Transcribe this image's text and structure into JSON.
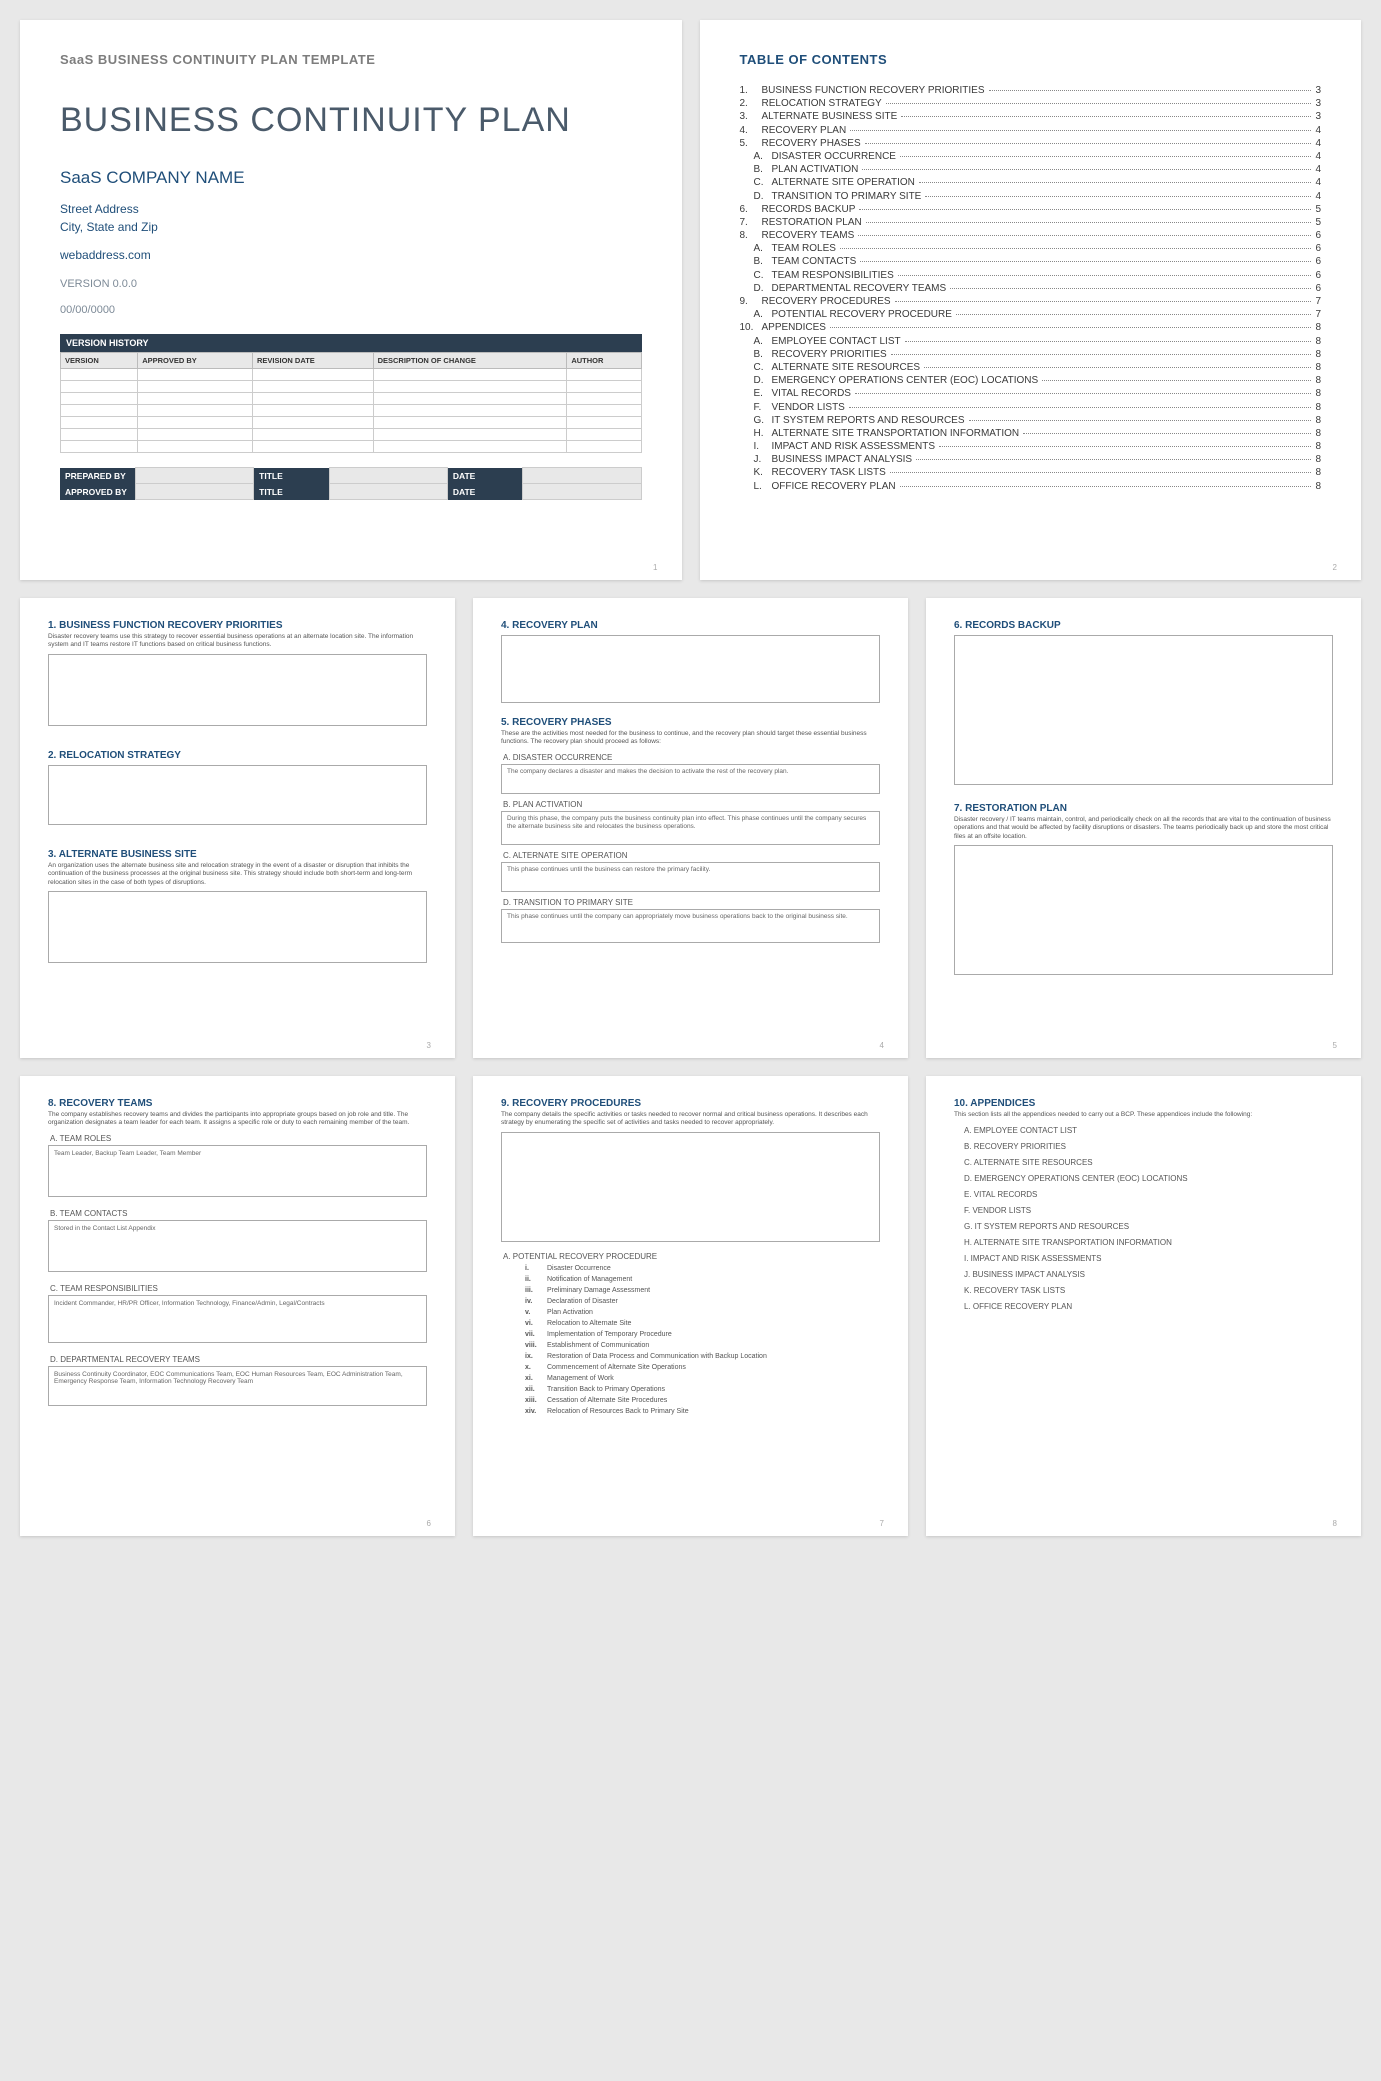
{
  "page1": {
    "header": "SaaS BUSINESS CONTINUITY PLAN TEMPLATE",
    "title": "BUSINESS CONTINUITY PLAN",
    "company": "SaaS COMPANY NAME",
    "street": "Street Address",
    "city": "City, State and Zip",
    "web": "webaddress.com",
    "version": "VERSION 0.0.0",
    "date": "00/00/0000",
    "vh_title": "VERSION HISTORY",
    "vh_cols": [
      "VERSION",
      "APPROVED BY",
      "REVISION DATE",
      "DESCRIPTION OF CHANGE",
      "AUTHOR"
    ],
    "sig": {
      "prepared": "PREPARED BY",
      "approved": "APPROVED BY",
      "title": "TITLE",
      "date": "DATE"
    },
    "pnum": "1"
  },
  "page2": {
    "title": "TABLE OF CONTENTS",
    "items": [
      {
        "n": "1.",
        "t": "BUSINESS FUNCTION RECOVERY PRIORITIES",
        "p": "3"
      },
      {
        "n": "2.",
        "t": "RELOCATION STRATEGY",
        "p": "3"
      },
      {
        "n": "3.",
        "t": "ALTERNATE BUSINESS SITE",
        "p": "3"
      },
      {
        "n": "4.",
        "t": "RECOVERY PLAN",
        "p": "4"
      },
      {
        "n": "5.",
        "t": "RECOVERY PHASES",
        "p": "4"
      },
      {
        "n": "A.",
        "t": "DISASTER OCCURRENCE",
        "p": "4",
        "sub": true
      },
      {
        "n": "B.",
        "t": "PLAN ACTIVATION",
        "p": "4",
        "sub": true
      },
      {
        "n": "C.",
        "t": "ALTERNATE SITE OPERATION",
        "p": "4",
        "sub": true
      },
      {
        "n": "D.",
        "t": "TRANSITION TO PRIMARY SITE",
        "p": "4",
        "sub": true
      },
      {
        "n": "6.",
        "t": "RECORDS BACKUP",
        "p": "5"
      },
      {
        "n": "7.",
        "t": "RESTORATION PLAN",
        "p": "5"
      },
      {
        "n": "8.",
        "t": "RECOVERY TEAMS",
        "p": "6"
      },
      {
        "n": "A.",
        "t": "TEAM ROLES",
        "p": "6",
        "sub": true
      },
      {
        "n": "B.",
        "t": "TEAM CONTACTS",
        "p": "6",
        "sub": true
      },
      {
        "n": "C.",
        "t": "TEAM RESPONSIBILITIES",
        "p": "6",
        "sub": true
      },
      {
        "n": "D.",
        "t": "DEPARTMENTAL RECOVERY TEAMS",
        "p": "6",
        "sub": true
      },
      {
        "n": "9.",
        "t": "RECOVERY PROCEDURES",
        "p": "7"
      },
      {
        "n": "A.",
        "t": "POTENTIAL RECOVERY PROCEDURE",
        "p": "7",
        "sub": true
      },
      {
        "n": "10.",
        "t": "APPENDICES",
        "p": "8"
      },
      {
        "n": "A.",
        "t": "EMPLOYEE CONTACT LIST",
        "p": "8",
        "sub": true
      },
      {
        "n": "B.",
        "t": "RECOVERY PRIORITIES",
        "p": "8",
        "sub": true
      },
      {
        "n": "C.",
        "t": "ALTERNATE SITE RESOURCES",
        "p": "8",
        "sub": true
      },
      {
        "n": "D.",
        "t": "EMERGENCY OPERATIONS CENTER (EOC) LOCATIONS",
        "p": "8",
        "sub": true
      },
      {
        "n": "E.",
        "t": "VITAL RECORDS",
        "p": "8",
        "sub": true
      },
      {
        "n": "F.",
        "t": "VENDOR LISTS",
        "p": "8",
        "sub": true
      },
      {
        "n": "G.",
        "t": "IT SYSTEM REPORTS AND RESOURCES",
        "p": "8",
        "sub": true
      },
      {
        "n": "H.",
        "t": "ALTERNATE SITE TRANSPORTATION INFORMATION",
        "p": "8",
        "sub": true
      },
      {
        "n": "I.",
        "t": "IMPACT AND RISK ASSESSMENTS",
        "p": "8",
        "sub": true
      },
      {
        "n": "J.",
        "t": "BUSINESS IMPACT ANALYSIS",
        "p": "8",
        "sub": true
      },
      {
        "n": "K.",
        "t": "RECOVERY TASK LISTS",
        "p": "8",
        "sub": true
      },
      {
        "n": "L.",
        "t": "OFFICE RECOVERY PLAN",
        "p": "8",
        "sub": true
      }
    ],
    "pnum": "2"
  },
  "page3": {
    "s1_title": "1. BUSINESS FUNCTION RECOVERY PRIORITIES",
    "s1_desc": "Disaster recovery teams use this strategy to recover essential business operations at an alternate location site. The information system and IT teams restore IT functions based on critical business functions.",
    "s2_title": "2. RELOCATION STRATEGY",
    "s3_title": "3. ALTERNATE BUSINESS SITE",
    "s3_desc": "An organization uses the alternate business site and relocation strategy in the event of a disaster or disruption that inhibits the continuation of the business processes at the original business site. This strategy should include both short-term and long-term relocation sites in the case of both types of disruptions.",
    "pnum": "3"
  },
  "page4": {
    "s4_title": "4. RECOVERY PLAN",
    "s5_title": "5. RECOVERY PHASES",
    "s5_desc": "These are the activities most needed for the business to continue, and the recovery plan should target these essential business functions. The recovery plan should proceed as follows:",
    "a_title": "A. DISASTER OCCURRENCE",
    "a_txt": "The company declares a disaster and makes the decision to activate the rest of the recovery plan.",
    "b_title": "B. PLAN ACTIVATION",
    "b_txt": "During this phase, the company puts the business continuity plan into effect. This phase continues until the company secures the alternate business site and relocates the business operations.",
    "c_title": "C. ALTERNATE SITE OPERATION",
    "c_txt": "This phase continues until the business can restore the primary facility.",
    "d_title": "D. TRANSITION TO PRIMARY SITE",
    "d_txt": "This phase continues until the company can appropriately move business operations back to the original business site.",
    "pnum": "4"
  },
  "page5": {
    "s6_title": "6. RECORDS BACKUP",
    "s7_title": "7. RESTORATION PLAN",
    "s7_desc": "Disaster recovery / IT teams maintain, control, and periodically check on all the records that are vital to the continuation of business operations and that would be affected by facility disruptions or disasters. The teams periodically back up and store the most critical files at an offsite location.",
    "pnum": "5"
  },
  "page6": {
    "s8_title": "8. RECOVERY TEAMS",
    "s8_desc": "The company establishes recovery teams and divides the participants into appropriate groups based on job role and title. The organization designates a team leader for each team. It assigns a specific role or duty to each remaining member of the team.",
    "a_title": "A. TEAM ROLES",
    "a_txt": "Team Leader, Backup Team Leader, Team Member",
    "b_title": "B. TEAM CONTACTS",
    "b_txt": "Stored in the Contact List Appendix",
    "c_title": "C. TEAM RESPONSIBILITIES",
    "c_txt": "Incident Commander, HR/PR Officer, Information Technology, Finance/Admin, Legal/Contracts",
    "d_title": "D. DEPARTMENTAL RECOVERY TEAMS",
    "d_txt": "Business Continuity Coordinator, EOC Communications Team, EOC Human Resources Team, EOC Administration Team, Emergency Response Team, Information Technology Recovery Team",
    "pnum": "6"
  },
  "page7": {
    "s9_title": "9. RECOVERY PROCEDURES",
    "s9_desc": "The company details the specific activities or tasks needed to recover normal and critical business operations. It describes each strategy by enumerating the specific set of activities and tasks needed to recover appropriately.",
    "a_title": "A. POTENTIAL RECOVERY PROCEDURE",
    "steps": [
      {
        "n": "i.",
        "t": "Disaster Occurrence"
      },
      {
        "n": "ii.",
        "t": "Notification of Management"
      },
      {
        "n": "iii.",
        "t": "Preliminary Damage Assessment"
      },
      {
        "n": "iv.",
        "t": "Declaration of Disaster"
      },
      {
        "n": "v.",
        "t": "Plan Activation"
      },
      {
        "n": "vi.",
        "t": "Relocation to Alternate Site"
      },
      {
        "n": "vii.",
        "t": "Implementation of Temporary Procedure"
      },
      {
        "n": "viii.",
        "t": "Establishment of Communication"
      },
      {
        "n": "ix.",
        "t": "Restoration of Data Process and Communication with Backup Location"
      },
      {
        "n": "x.",
        "t": "Commencement of Alternate Site Operations"
      },
      {
        "n": "xi.",
        "t": "Management of Work"
      },
      {
        "n": "xii.",
        "t": "Transition Back to Primary Operations"
      },
      {
        "n": "xiii.",
        "t": "Cessation of Alternate Site Procedures"
      },
      {
        "n": "xiv.",
        "t": "Relocation of Resources Back to Primary Site"
      }
    ],
    "pnum": "7"
  },
  "page8": {
    "s10_title": "10.   APPENDICES",
    "s10_desc": "This section lists all the appendices needed to carry out a BCP. These appendices include the following:",
    "items": [
      "A. EMPLOYEE CONTACT LIST",
      "B. RECOVERY PRIORITIES",
      "C. ALTERNATE SITE RESOURCES",
      "D. EMERGENCY OPERATIONS CENTER (EOC) LOCATIONS",
      "E. VITAL RECORDS",
      "F. VENDOR LISTS",
      "G. IT SYSTEM REPORTS AND RESOURCES",
      "H. ALTERNATE SITE TRANSPORTATION INFORMATION",
      "I. IMPACT AND RISK ASSESSMENTS",
      "J. BUSINESS IMPACT ANALYSIS",
      "K. RECOVERY TASK LISTS",
      "L. OFFICE RECOVERY PLAN"
    ],
    "pnum": "8"
  }
}
